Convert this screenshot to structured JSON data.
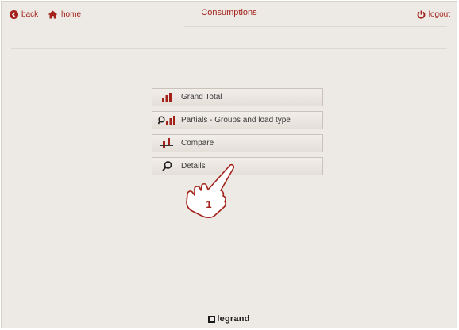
{
  "header": {
    "back_label": "back",
    "home_label": "home",
    "title": "Consumptions",
    "logout_label": "logout"
  },
  "menu": {
    "items": [
      {
        "label": "Grand Total",
        "icon": "bar-chart-icon"
      },
      {
        "label": "Partials - Groups and load type",
        "icon": "search-bar-chart-icon"
      },
      {
        "label": "Compare",
        "icon": "compare-chart-icon"
      },
      {
        "label": "Details",
        "icon": "magnifier-icon"
      }
    ]
  },
  "callout": {
    "number": "1",
    "icon": "pointing-hand-icon"
  },
  "brand": {
    "name": "legrand"
  },
  "colors": {
    "accent": "#a3211b",
    "background": "#ede9e4",
    "button_border": "#c9c3bc",
    "text": "#3a3a3a"
  }
}
